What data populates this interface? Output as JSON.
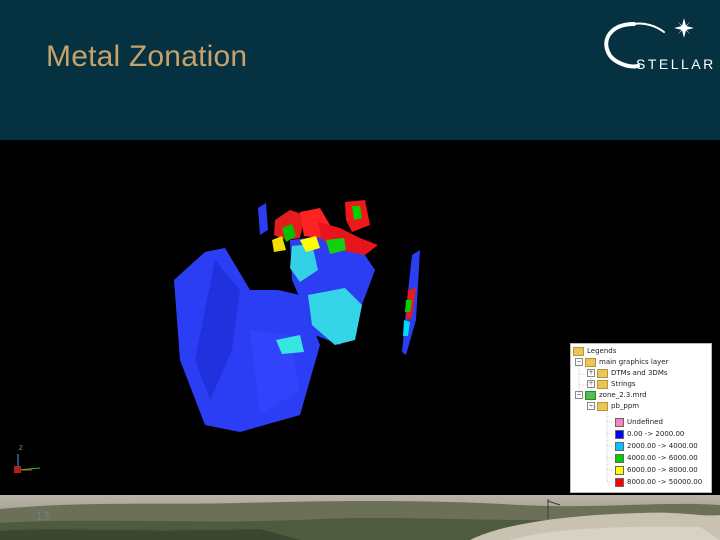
{
  "slide": {
    "title": "Metal Zonation",
    "page_number": "13"
  },
  "logo": {
    "text": "STELLAR",
    "icon": "star-arc-logo-icon"
  },
  "colors": {
    "header_bg": "#063140",
    "title": "#c7a26a",
    "viewport_bg": "#000000"
  },
  "axes_widget": {
    "z_label": "Z",
    "icon": "axis-triad-icon"
  },
  "legend": {
    "title": "Legends",
    "items": [
      {
        "label": "main graphics layer",
        "indent": 1
      },
      {
        "label": "DTMs and 3DMs",
        "indent": 2
      },
      {
        "label": "Strings",
        "indent": 2
      },
      {
        "label": "zone_2.3.mrd",
        "indent": 2
      },
      {
        "label": "pb_ppm",
        "indent": 3
      }
    ],
    "ranges": [
      {
        "label": "Undefined",
        "color": "#ff80c0"
      },
      {
        "label": "0.00 -> 2000.00",
        "color": "#0000ff"
      },
      {
        "label": "2000.00 -> 4000.00",
        "color": "#00c8ff"
      },
      {
        "label": "4000.00 -> 6000.00",
        "color": "#00d000"
      },
      {
        "label": "6000.00 -> 8000.00",
        "color": "#ffff00"
      },
      {
        "label": "8000.00 -> 50000.00",
        "color": "#ff0000"
      }
    ]
  }
}
